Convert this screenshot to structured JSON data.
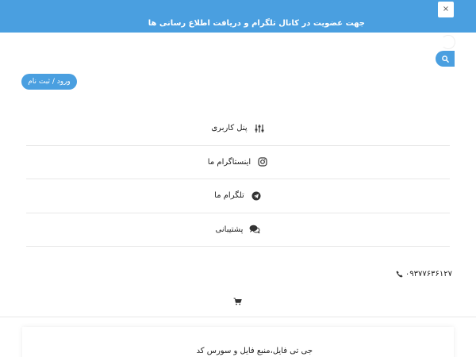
{
  "topbar": {
    "message": "جهت عضویت در کانال تلگرام و دریافت اطلاع رسانی ها",
    "close_label": "×"
  },
  "header": {
    "login_label": "ورود / ثبت نام"
  },
  "menu": {
    "items": [
      {
        "label": "پنل کاربری",
        "icon": "sliders-icon"
      },
      {
        "label": "اینستاگرام ما",
        "icon": "instagram-icon"
      },
      {
        "label": "تلگرام ما",
        "icon": "telegram-icon"
      },
      {
        "label": "پشتیبانی",
        "icon": "chat-icon"
      }
    ]
  },
  "contact": {
    "phone": "۰۹۳۷۷۶۳۶۱۲۷"
  },
  "footer": {
    "title": "جی تی فایل،منبع فایل و سورس کد"
  },
  "colors": {
    "accent": "#4a9fe0"
  }
}
